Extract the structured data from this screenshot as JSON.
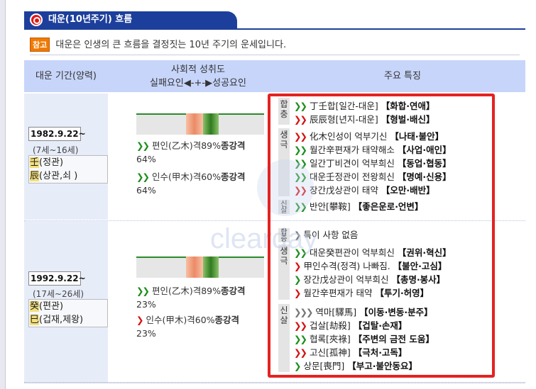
{
  "title": "대운(10년주기) 흐름",
  "note": {
    "badge": "참고",
    "text": "대운은 인생의 큰 흐름을 결정짓는 10년 주기의 운세입니다."
  },
  "header": {
    "period": "대운 기간(양력)",
    "social_line1": "사회적 성취도",
    "social_line2": "실패요인◀-+-▶성공요인",
    "features": "주요 특징"
  },
  "periods": [
    {
      "date": "1982.9.22~",
      "age": "(7세~16세)",
      "gan_char": "壬",
      "gan_desc": "(정관)",
      "ji_char": "辰",
      "ji_desc": "(상관,쇠 )",
      "bar": {
        "fail_fraction": 0.38,
        "success_fraction": 0.62
      },
      "causes": [
        {
          "arrow": "green",
          "text": "편인(乙木)격89%",
          "bold": "종강격",
          "value": "64%"
        },
        {
          "arrow": "green",
          "text": "인수(甲木)격60%",
          "bold": "종강격",
          "value": "64%"
        }
      ],
      "feature_groups": [
        {
          "label": "합충",
          "items": [
            {
              "arrow": "green",
              "text": "丁壬합[일간-대운] ",
              "bold": "【화합·연애】"
            },
            {
              "arrow": "red",
              "text": "辰辰형[년지-대운] ",
              "bold": "【형벌·배신】"
            }
          ]
        },
        {
          "label": "생극",
          "items": [
            {
              "arrow": "red",
              "text": "化木인성이 억부기신 ",
              "bold": "【나태·불안】"
            },
            {
              "arrow": "green",
              "text": "월간辛편재가 태약해소 ",
              "bold": "【사업·애인】"
            },
            {
              "arrow": "green",
              "text": "일간丁비견이 억부희신 ",
              "bold": "【동업·협동】"
            },
            {
              "arrow": "green",
              "text": "대운壬정관이 전왕희신 ",
              "bold": "【명예·신용】"
            },
            {
              "arrow": "red",
              "text": "장간戊상관이 태약 ",
              "bold": "【오만·배반】"
            }
          ]
        },
        {
          "label": "신살",
          "items": [
            {
              "arrow": "green",
              "text": "반안[攀鞍] ",
              "bold": "【좋은운로·언변】"
            }
          ]
        }
      ]
    },
    {
      "date": "1992.9.22~",
      "age": "(17세~26세)",
      "gan_char": "癸",
      "gan_desc": "(편관)",
      "ji_char": "巳",
      "ji_desc": "(겁재,제왕)",
      "bar": {
        "fail_fraction": 0.38,
        "success_fraction": 0.62
      },
      "causes": [
        {
          "arrow": "green",
          "text": "편인(乙木)격89%",
          "bold": "종강격",
          "value": "23%"
        },
        {
          "arrow": "red",
          "text": "인수(甲木)격60%",
          "bold": "종강격",
          "value": "23%"
        }
      ],
      "feature_groups": [
        {
          "label": "합충",
          "items": [
            {
              "arrow": "gray",
              "text": "특이 사항 없음",
              "bold": ""
            }
          ]
        },
        {
          "label": "생극",
          "items": [
            {
              "arrow": "green",
              "text": "대운癸편관이 억부희신 ",
              "bold": "【권위·혁신】"
            },
            {
              "arrow": "red",
              "text": "甲인수격(정격) 나빠짐. ",
              "bold": "【불안·고심】"
            },
            {
              "arrow": "green",
              "text": "장간戊상관이 억부희신 ",
              "bold": "【총명·봉사】"
            },
            {
              "arrow": "red",
              "text": "월간辛편재가 태약 ",
              "bold": "【투기·허영】"
            }
          ]
        },
        {
          "label": "신살",
          "items": [
            {
              "arrow": "gray",
              "text": "역마[驛馬] ",
              "bold": "【이동·변동·분주】"
            },
            {
              "arrow": "red",
              "text": "겁살[劫殺] ",
              "bold": "【겁탈·손재】"
            },
            {
              "arrow": "green",
              "text": "협록[夾祿] ",
              "bold": "【주변의 금전 도움】"
            },
            {
              "arrow": "red",
              "text": "고신[孤神] ",
              "bold": "【극처·고독】"
            },
            {
              "arrow": "green",
              "text": "상문[喪門] ",
              "bold": "【부고·불안동요】"
            }
          ]
        }
      ]
    }
  ],
  "watermark": "clearday",
  "colors": {
    "header_bg": "#c7d5fa",
    "title_bg": "#1d3f9c",
    "highlight_border": "#e42222",
    "fail_segment": "#f0a080",
    "success_segment": "#3a8a2a"
  },
  "icons": {
    "arrow_green": "double-chevron-right-green",
    "arrow_red": "double-chevron-right-red",
    "arrow_gray": "double-chevron-right-gray"
  }
}
